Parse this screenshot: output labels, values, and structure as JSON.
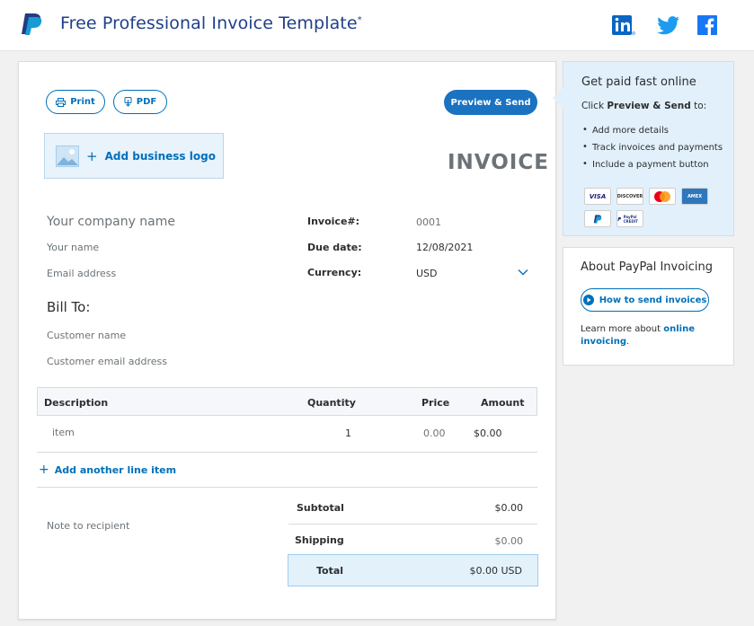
{
  "header": {
    "title": "Free Professional Invoice Template",
    "title_mark": "*",
    "social": [
      "linkedin-icon",
      "twitter-icon",
      "facebook-icon"
    ]
  },
  "toolbar": {
    "print_label": "Print",
    "pdf_label": "PDF",
    "preview_send_label": "Preview & Send"
  },
  "invoice": {
    "add_logo_label": "Add business logo",
    "heading": "INVOICE",
    "company_placeholder": "Your company name",
    "your_name_placeholder": "Your name",
    "email_placeholder": "Email address",
    "meta": {
      "invoice_no_label": "Invoice#:",
      "invoice_no_value": "0001",
      "due_date_label": "Due date:",
      "due_date_value": "12/08/2021",
      "currency_label": "Currency:",
      "currency_value": "USD"
    },
    "bill_to": {
      "heading": "Bill To:",
      "customer_name_placeholder": "Customer name",
      "customer_email_placeholder": "Customer email address"
    },
    "table": {
      "headers": [
        "Description",
        "Quantity",
        "Price",
        "Amount"
      ],
      "rows": [
        {
          "description": "item",
          "quantity": "1",
          "price": "0.00",
          "amount": "$0.00"
        }
      ],
      "add_line_label": "Add another line item"
    },
    "note_placeholder": "Note to recipient",
    "totals": {
      "subtotal_label": "Subtotal",
      "subtotal_value": "$0.00",
      "shipping_label": "Shipping",
      "shipping_value": "$0.00",
      "total_label": "Total",
      "total_value": "$0.00 USD"
    }
  },
  "get_paid": {
    "title": "Get paid fast online",
    "sub_prefix": "Click ",
    "sub_bold": "Preview & Send",
    "sub_suffix": " to:",
    "bullets": [
      "Add more details",
      "Track invoices and payments",
      "Include a payment button"
    ],
    "cards": [
      "VISA",
      "DISCOVER",
      "mastercard",
      "AMEX",
      "PayPal",
      "PayPal CREDIT"
    ]
  },
  "about": {
    "title": "About PayPal Invoicing",
    "button_label": "How to send invoices",
    "text_prefix": "Learn more about ",
    "text_link": "online invoicing",
    "text_suffix": "."
  },
  "colors": {
    "brand_blue": "#0070ba",
    "title_navy": "#1f3f8a",
    "primary_button": "#1b72c0",
    "callout_bg": "#e1f0fb"
  }
}
